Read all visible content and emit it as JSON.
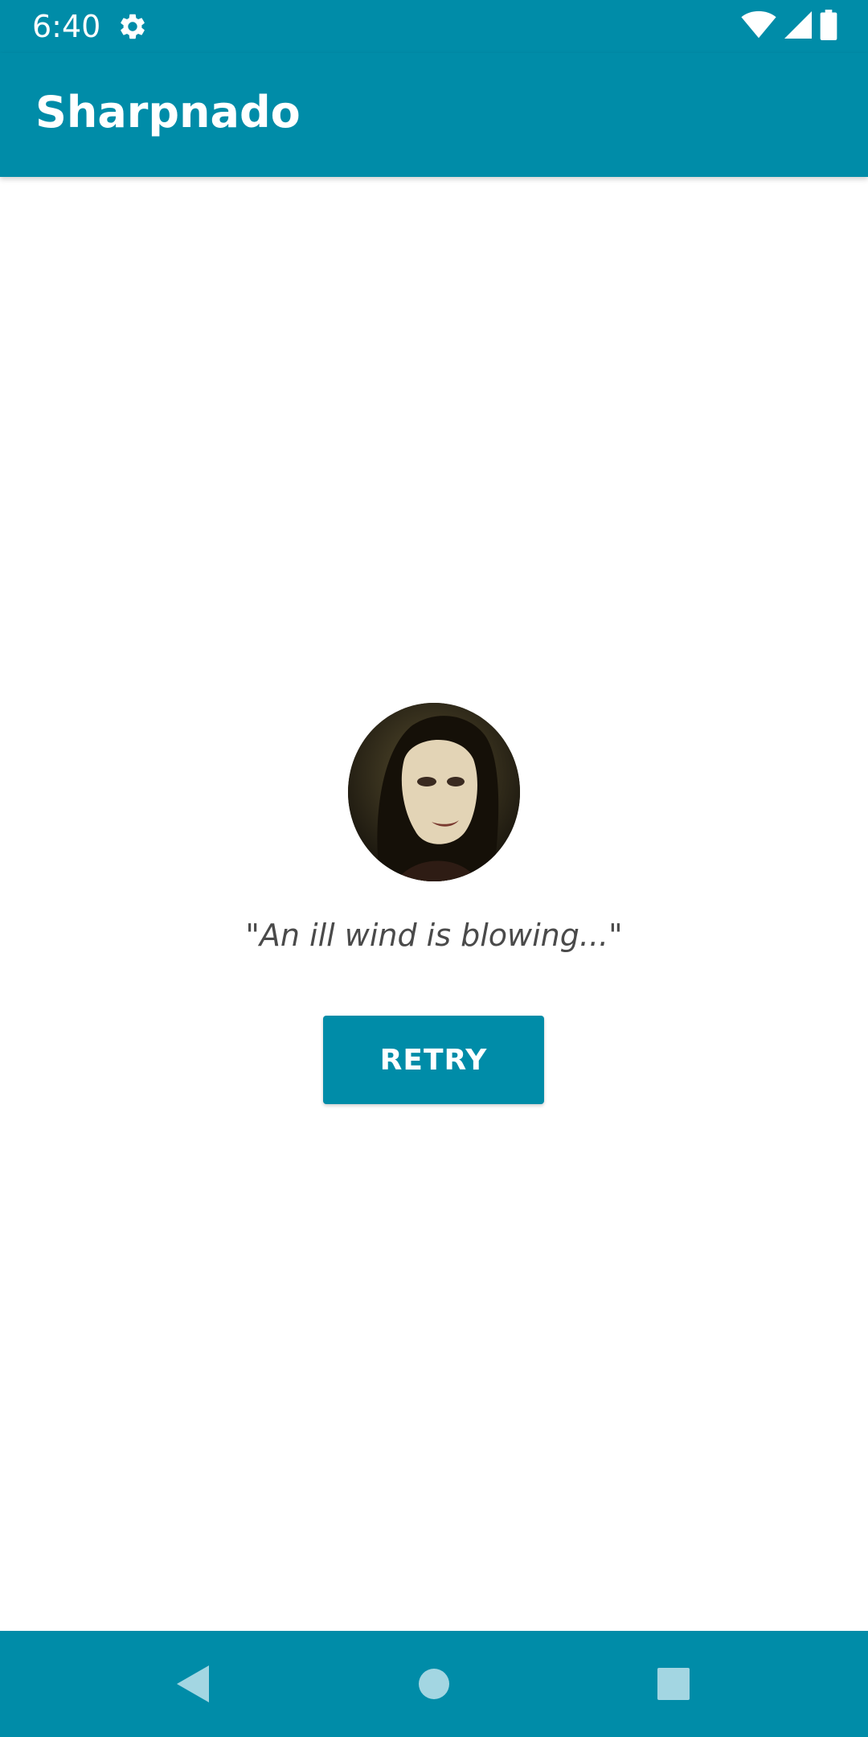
{
  "status_bar": {
    "time": "6:40",
    "icons": [
      "gear-icon",
      "wifi-icon",
      "signal-icon",
      "battery-icon"
    ]
  },
  "app_bar": {
    "title": "Sharpnado"
  },
  "error_view": {
    "avatar": "character-portrait",
    "quote": "\"An ill wind is blowing...\"",
    "retry_label": "RETRY"
  },
  "nav_bar": {
    "icons": [
      "back-icon",
      "home-icon",
      "recents-icon"
    ]
  },
  "colors": {
    "primary": "#008ca8",
    "background": "#ffffff",
    "quote_text": "#4a4a4a",
    "on_primary": "#ffffff"
  }
}
